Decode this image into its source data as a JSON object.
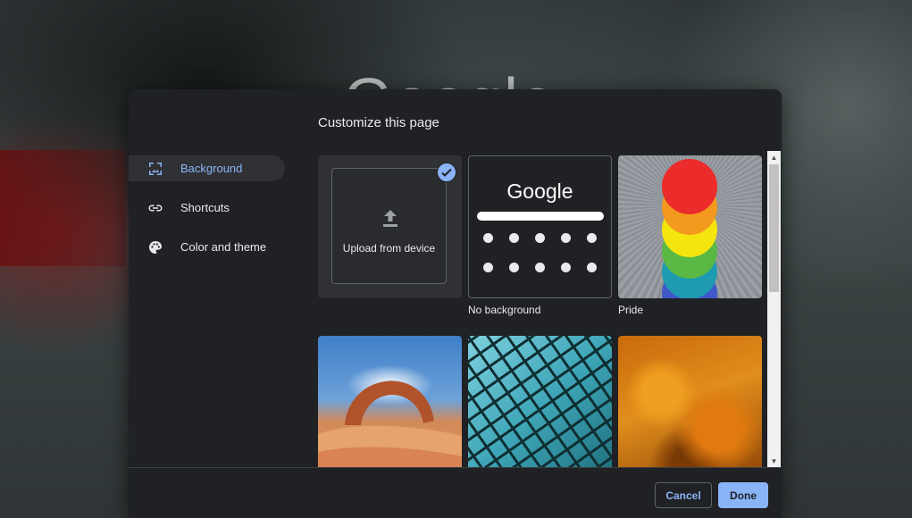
{
  "background_logo": "Google",
  "dialog": {
    "title": "Customize this page",
    "nav": [
      {
        "label": "Background",
        "icon": "image-icon",
        "active": true
      },
      {
        "label": "Shortcuts",
        "icon": "link-icon",
        "active": false
      },
      {
        "label": "Color and theme",
        "icon": "palette-icon",
        "active": false
      }
    ],
    "tiles": {
      "upload": {
        "label": "Upload from device",
        "selected": true
      },
      "no_background": {
        "label": "No background",
        "logo": "Google"
      },
      "pride": {
        "label": "Pride"
      }
    },
    "buttons": {
      "cancel": "Cancel",
      "done": "Done"
    }
  },
  "colors": {
    "accent": "#8ab4f8",
    "dialog_bg": "#202124",
    "text": "#e8eaed"
  }
}
